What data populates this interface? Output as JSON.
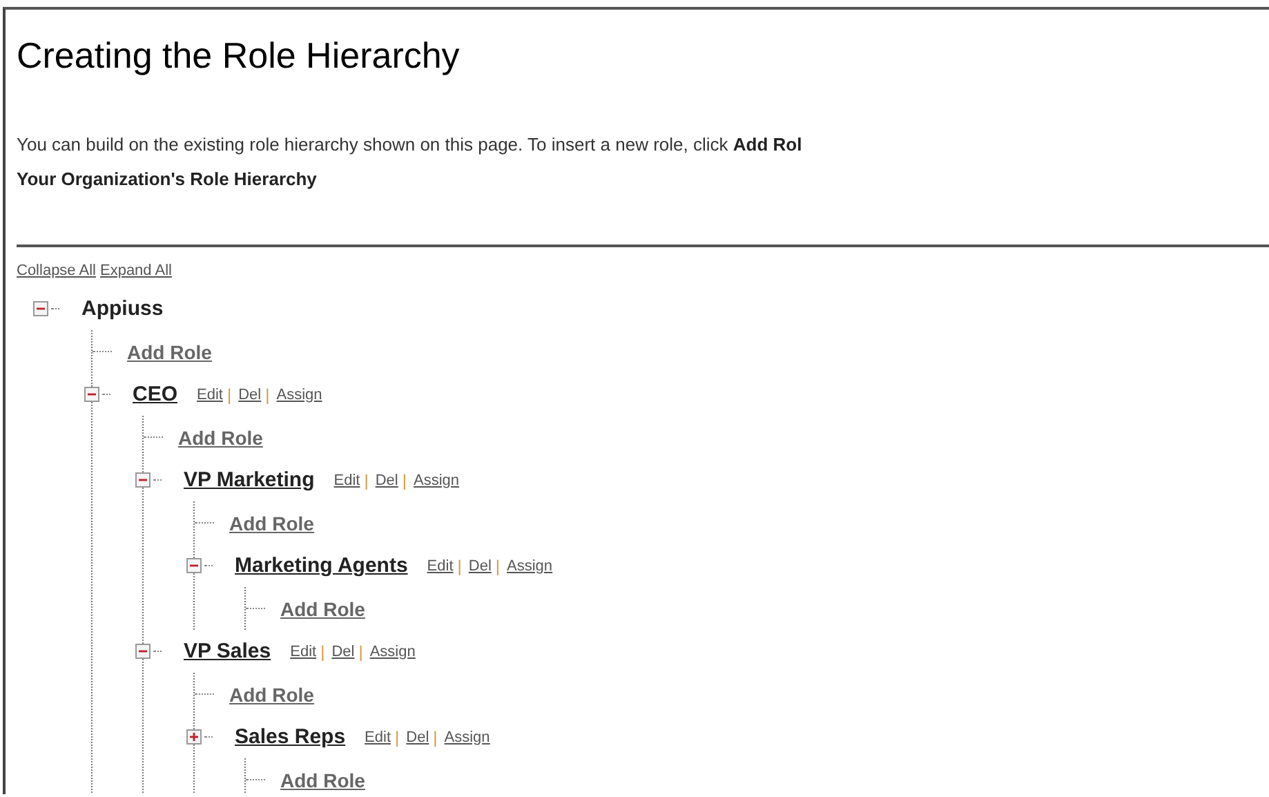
{
  "title": "Creating the Role Hierarchy",
  "intro": "You can build on the existing role hierarchy shown on this page. To insert a new role, click **Add Rol**",
  "section_heading": "Your Organization's Role Hierarchy",
  "tree_links": [
    "Collapse All",
    "Expand All"
  ],
  "separator": "|",
  "tree": [
    {
      "kind": "role",
      "name": "Appiuss",
      "expanded": true,
      "children": [
        {
          "kind": "add",
          "label": "Add Role"
        },
        {
          "kind": "role",
          "name": "CEO",
          "expanded": true,
          "actions": [
            "Edit",
            "Del",
            "Assign"
          ],
          "children": [
            {
              "kind": "add",
              "label": "Add Role"
            },
            {
              "kind": "role",
              "name": "VP Marketing",
              "expanded": true,
              "actions": [
                "Edit",
                "Del",
                "Assign"
              ],
              "children": [
                {
                  "kind": "add",
                  "label": "Add Role"
                },
                {
                  "kind": "role",
                  "name": "Marketing Agents",
                  "expanded": true,
                  "actions": [
                    "Edit",
                    "Del",
                    "Assign"
                  ],
                  "children": [
                    {
                      "kind": "add",
                      "label": "Add Role"
                    }
                  ]
                }
              ]
            },
            {
              "kind": "role",
              "name": "VP Sales",
              "expanded": true,
              "actions": [
                "Edit",
                "Del",
                "Assign"
              ],
              "children": [
                {
                  "kind": "add",
                  "label": "Add Role"
                },
                {
                  "kind": "role",
                  "name": "Sales Reps",
                  "expanded": false,
                  "actions": [
                    "Edit",
                    "Del",
                    "Assign"
                  ],
                  "children": [
                    {
                      "kind": "add",
                      "label": "Add Role"
                    }
                  ]
                }
              ]
            }
          ]
        }
      ]
    }
  ]
}
